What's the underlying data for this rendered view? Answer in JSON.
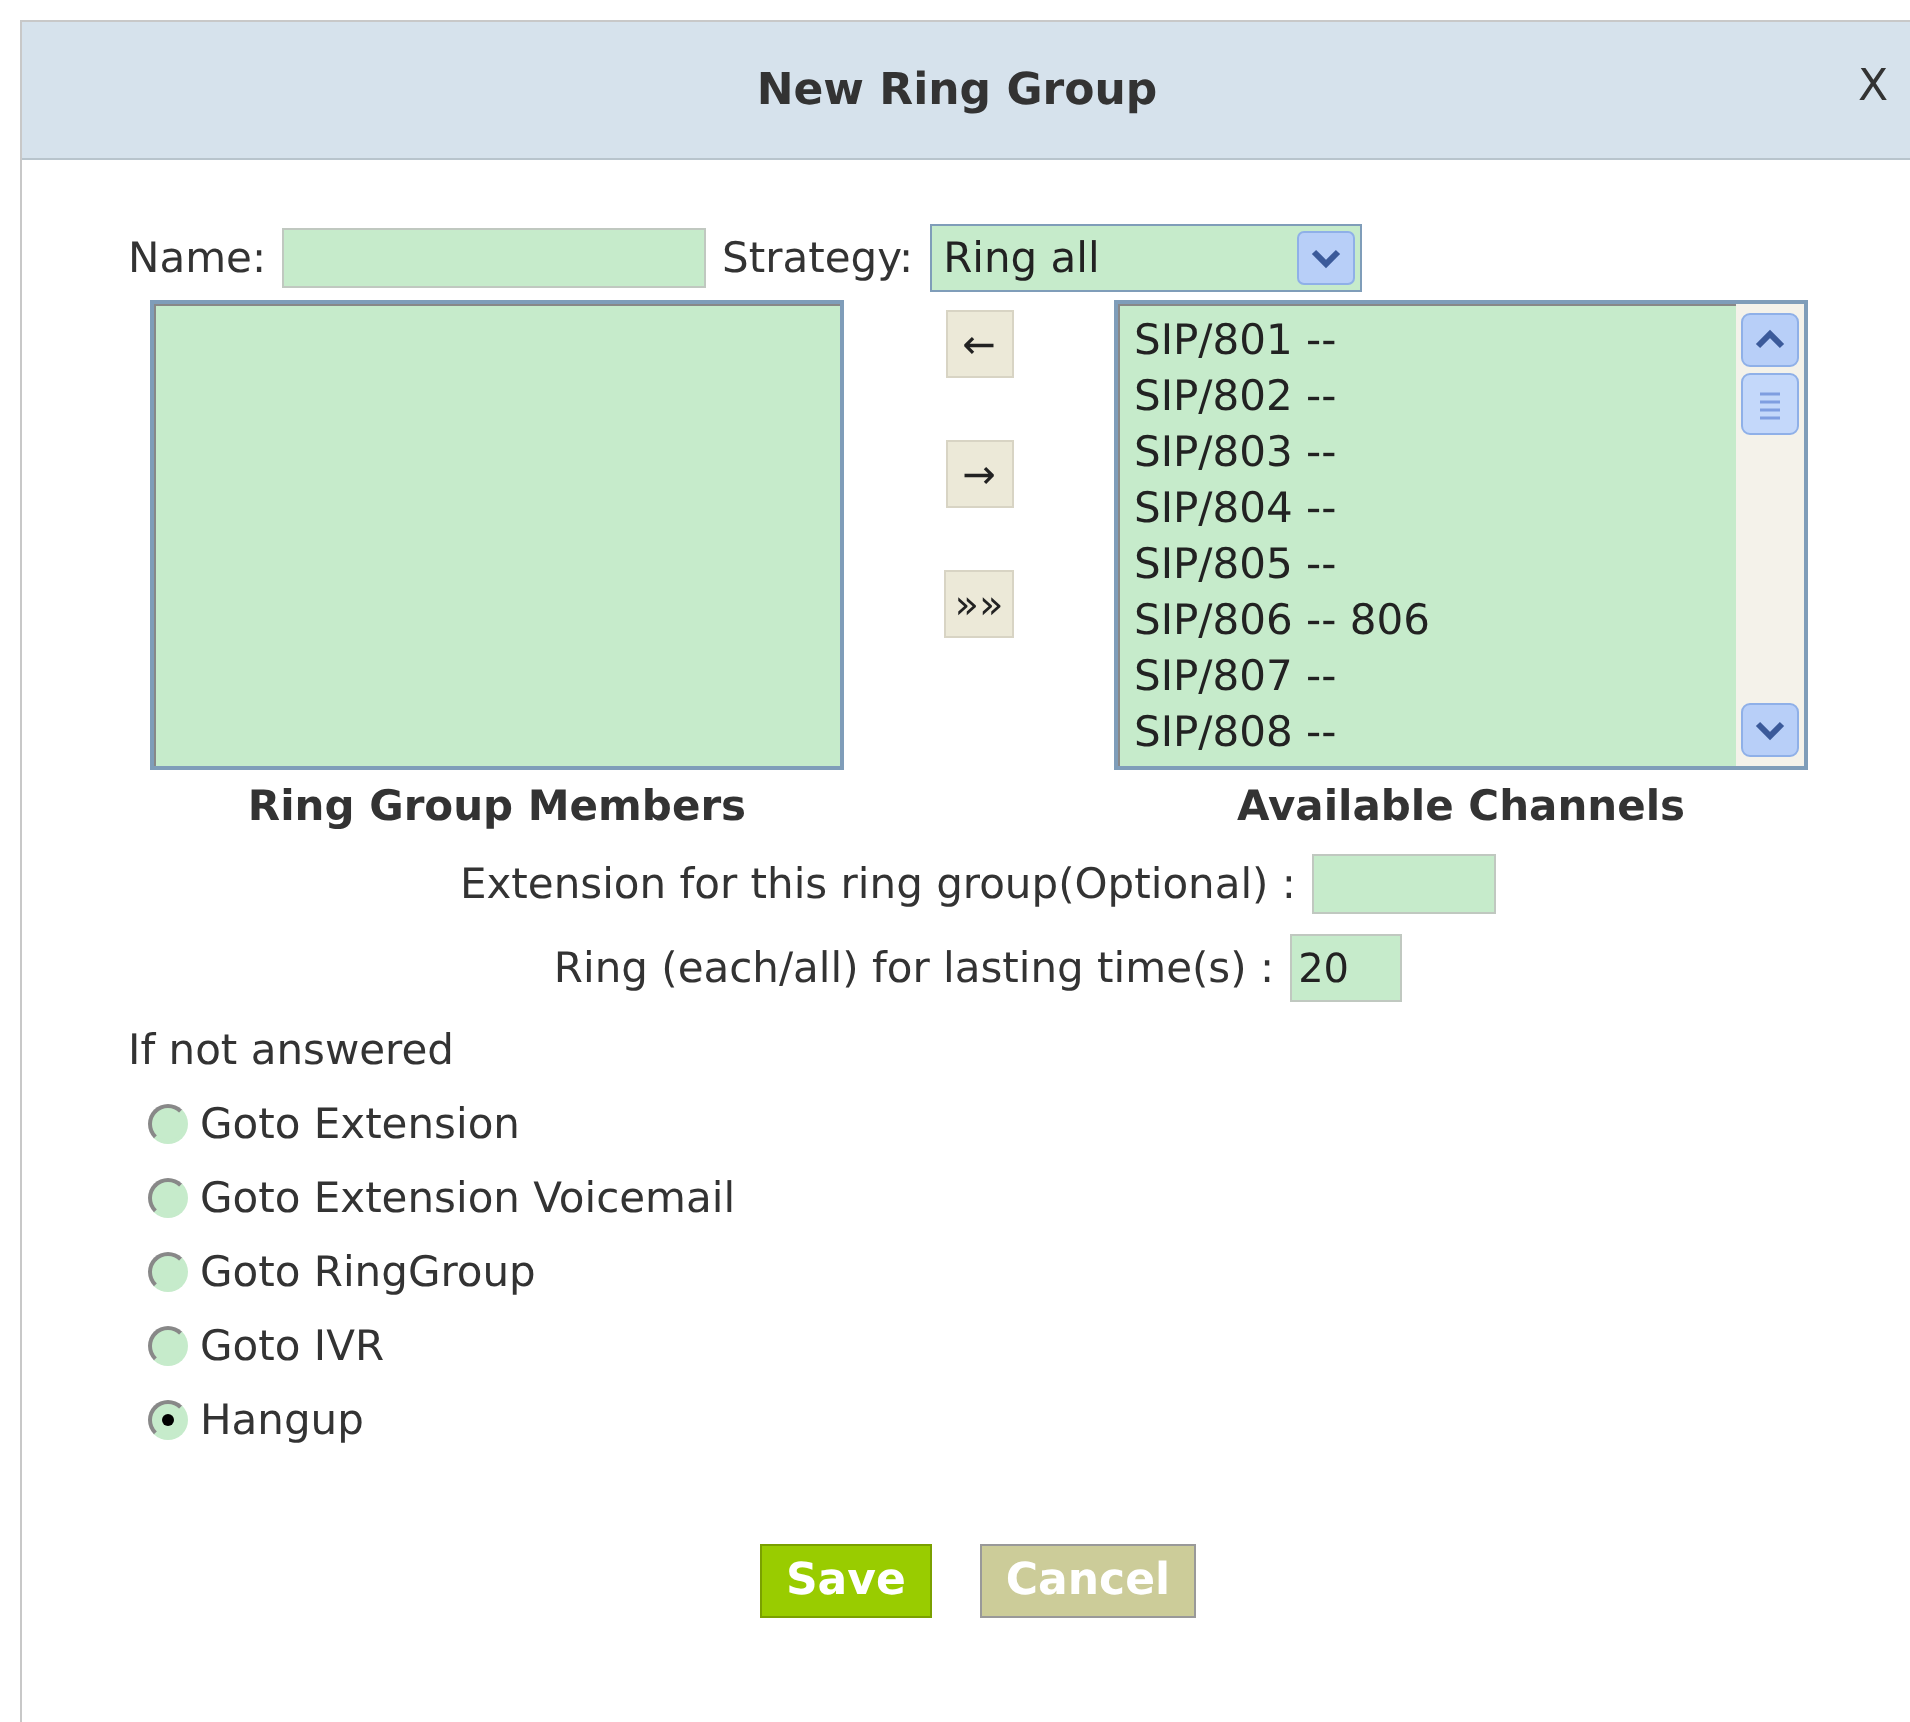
{
  "dialog": {
    "title": "New Ring Group",
    "close": "X"
  },
  "name_field": {
    "label": "Name:"
  },
  "strategy": {
    "label": "Strategy:",
    "value": "Ring all"
  },
  "members": {
    "label": "Ring Group Members"
  },
  "move_buttons": [
    "←",
    "→",
    "»»"
  ],
  "channels": {
    "label": "Available Channels",
    "items": [
      "SIP/801 --",
      "SIP/802 --",
      "SIP/803 --",
      "SIP/804 --",
      "SIP/805 --",
      "SIP/806 -- 806",
      "SIP/807 --",
      "SIP/808 --"
    ]
  },
  "extension_field": {
    "label": "Extension for this ring group(Optional) :"
  },
  "ring_time_field": {
    "label": "Ring (each/all) for lasting time(s) :",
    "value": "20"
  },
  "if_not_answered": {
    "label": "If not answered",
    "options": [
      {
        "label": "Goto Extension",
        "selected": false
      },
      {
        "label": "Goto Extension Voicemail",
        "selected": false
      },
      {
        "label": "Goto RingGroup",
        "selected": false
      },
      {
        "label": "Goto IVR",
        "selected": false
      },
      {
        "label": "Hangup",
        "selected": true
      }
    ]
  },
  "buttons": [
    {
      "label": "Save",
      "kind": "primary"
    },
    {
      "label": "Cancel",
      "kind": "secondary"
    }
  ]
}
